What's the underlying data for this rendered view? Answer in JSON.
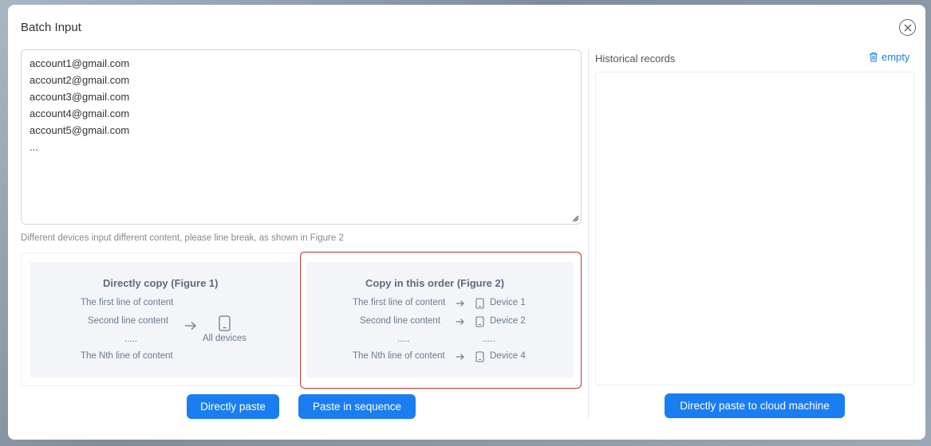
{
  "dialog": {
    "title": "Batch Input"
  },
  "input": {
    "value": "account1@gmail.com\naccount2@gmail.com\naccount3@gmail.com\naccount4@gmail.com\naccount5@gmail.com\n..."
  },
  "hint": "Different devices input different content, please line break, as shown in Figure 2",
  "figure1": {
    "title": "Directly copy (Figure 1)",
    "lines": [
      "The first line of content",
      "Second line content",
      ".....",
      "The Nth line of content"
    ],
    "target": "All devices"
  },
  "figure2": {
    "title": "Copy in this order (Figure 2)",
    "rows": [
      {
        "line": "The first line of content",
        "device": "Device 1"
      },
      {
        "line": "Second line content",
        "device": "Device 2"
      },
      {
        "line": ".....",
        "device": "....."
      },
      {
        "line": "The Nth line of content",
        "device": "Device 4"
      }
    ]
  },
  "buttons": {
    "direct_paste": "Directly paste",
    "paste_sequence": "Paste in sequence",
    "paste_cloud": "Directly paste to cloud machine"
  },
  "history": {
    "label": "Historical records",
    "empty_label": "empty"
  },
  "colors": {
    "accent": "#1a7ef0",
    "highlight_border": "#c0392b"
  }
}
